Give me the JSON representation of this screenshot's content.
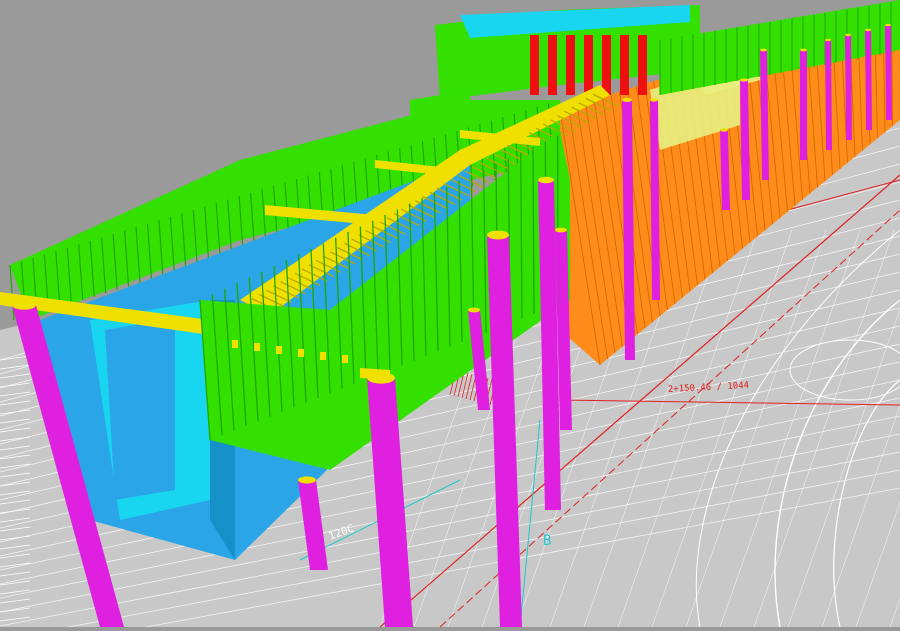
{
  "scene": {
    "colors": {
      "sky": "#9a9a9a",
      "ground": "#c8c8c8",
      "cad_lines": "#ffffff",
      "cad_red": "#e02020",
      "cad_cyan": "#20c8d0",
      "sheet_pile_green": "#33e000",
      "sheet_pile_green_dark": "#1ea800",
      "channel_blue": "#2aa6e8",
      "channel_cyan": "#18d6f0",
      "struts_yellow": "#f0e000",
      "piles_magenta": "#e020e0",
      "sheet_pile_orange": "#ff8c1a",
      "column_red": "#ee1010",
      "pale_yellow": "#e8f080"
    },
    "labels": {
      "dim_long": "2+150.46 / 1044",
      "dim_short": "120C",
      "grid_b": "B"
    }
  }
}
